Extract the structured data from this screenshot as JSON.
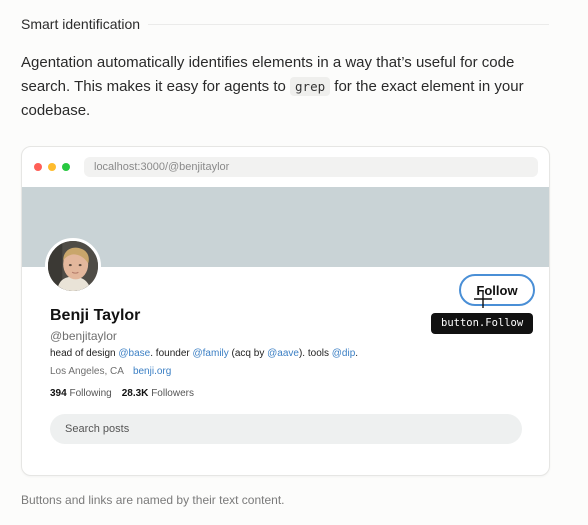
{
  "section": {
    "title": "Smart identification"
  },
  "intro": {
    "part1": "Agentation automatically identifies elements in a way that’s useful for code search. This makes it easy for agents to ",
    "code": "grep",
    "part2": " for the exact element in your codebase."
  },
  "browser": {
    "url": "localhost:3000/@benjitaylor",
    "profile": {
      "name": "Benji Taylor",
      "handle": "@benjitaylor",
      "bio": {
        "t1": "head of design ",
        "m1": "@base",
        "t2": ". founder ",
        "m2": "@family",
        "t3": " (acq by ",
        "m3": "@aave",
        "t4": "). tools ",
        "m4": "@dip",
        "t5": "."
      },
      "location": "Los Angeles, CA",
      "website": "benji.org",
      "following_count": "394",
      "following_label": "Following",
      "followers_count": "28.3K",
      "followers_label": "Followers",
      "follow_label": "Follow",
      "search_placeholder": "Search posts"
    },
    "tooltip": "button.Follow"
  },
  "caption": "Buttons and links are named by their text content.",
  "colors": {
    "banner": "#c9d3d6",
    "accent": "#4a8fd6",
    "mention": "#3b7fc4",
    "tooltip_bg": "#111111"
  },
  "icons": [
    "crosshair-icon"
  ]
}
